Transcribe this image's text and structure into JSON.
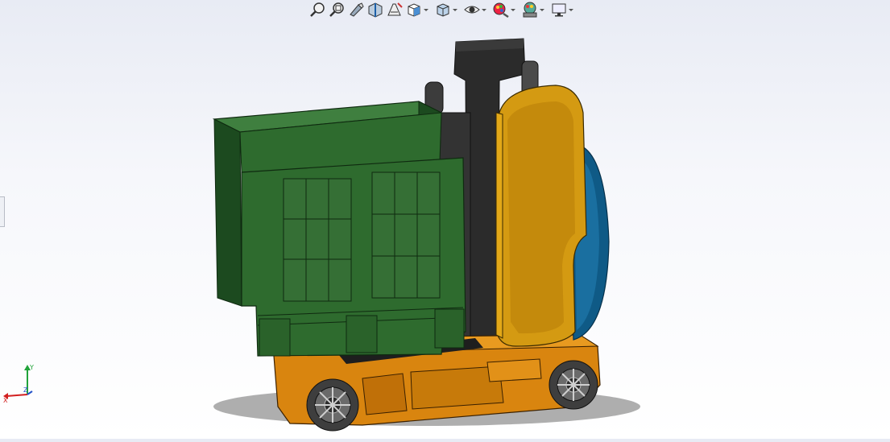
{
  "heads_up_toolbar": {
    "tools": [
      {
        "name": "zoom-to-fit"
      },
      {
        "name": "zoom-to-area"
      },
      {
        "name": "previous-view"
      },
      {
        "name": "section-view"
      },
      {
        "name": "dynamic-annotation-views"
      },
      {
        "name": "view-orientation",
        "has_dropdown": true
      },
      {
        "name": "display-style",
        "has_dropdown": true
      },
      {
        "name": "hide-show-items",
        "has_dropdown": true
      },
      {
        "name": "edit-appearance",
        "has_dropdown": true
      },
      {
        "name": "apply-scene",
        "has_dropdown": true
      },
      {
        "name": "view-settings",
        "has_dropdown": true
      }
    ]
  },
  "triad": {
    "x_label": "X",
    "y_label": "Y",
    "z_label": "Z",
    "x_color": "#d22020",
    "y_color": "#21a33a",
    "z_color": "#2452c8"
  },
  "model": {
    "colors": {
      "bin": "#2e6b2e",
      "bin_dark": "#1c4a1f",
      "chassis": "#d9850f",
      "cabin": "#d49a12",
      "rear_cover": "#0f5a86",
      "mast": "#2b2b2b",
      "wheel": "#4a4a4a"
    }
  }
}
